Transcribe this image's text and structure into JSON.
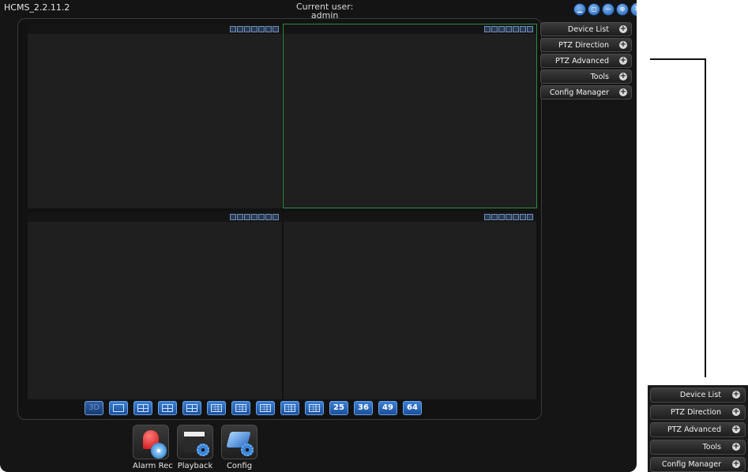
{
  "app": {
    "title": "HCMS_2.2.11.2",
    "current_user_label": "Current user:",
    "current_user": "admin"
  },
  "window_buttons": [
    "minimize",
    "restore",
    "maximize",
    "fullscreen",
    "close"
  ],
  "video_cells": [
    {
      "id": 1,
      "active": false
    },
    {
      "id": 2,
      "active": true
    },
    {
      "id": 3,
      "active": false
    },
    {
      "id": 4,
      "active": false
    }
  ],
  "cell_tool_icons": [
    "snapshot-icon",
    "record-icon",
    "talk-icon",
    "fit-icon",
    "zoom-icon",
    "audio-icon",
    "close-icon"
  ],
  "layout_buttons": {
    "threed": "3D",
    "n25": "25",
    "n36": "36",
    "n49": "49",
    "n64": "64"
  },
  "side_menu": [
    {
      "label": "Device List"
    },
    {
      "label": "PTZ Direction"
    },
    {
      "label": "PTZ Advanced"
    },
    {
      "label": "Tools"
    },
    {
      "label": "Config Manager"
    }
  ],
  "dock": [
    {
      "label": "Alarm Rec"
    },
    {
      "label": "Playback"
    },
    {
      "label": "Config"
    }
  ],
  "colors": {
    "active_cell_border": "#2e8b3e",
    "accent_blue": "#2f6fc4"
  }
}
